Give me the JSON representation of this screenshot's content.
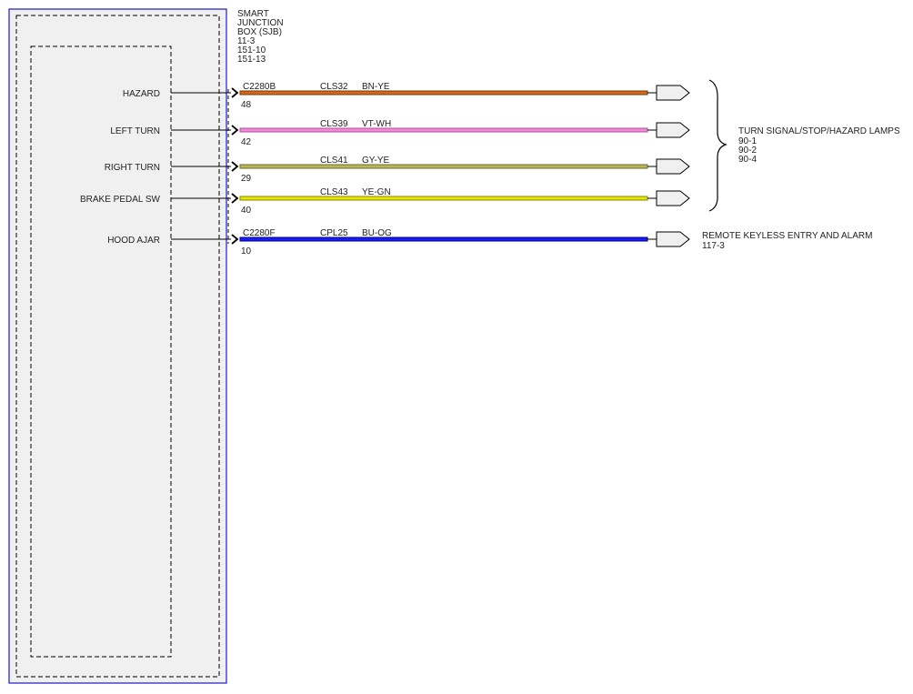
{
  "sjb": {
    "title_lines": [
      "SMART",
      "JUNCTION",
      "BOX (SJB)",
      "11-3",
      "151-10",
      "151-13"
    ]
  },
  "circuits": [
    {
      "input_label": "HAZARD",
      "connector": "C2280B",
      "pin": "48",
      "circuit": "CLS32",
      "wire_color": "BN-YE",
      "fill": "#d2691e",
      "stroke": "#7a3400"
    },
    {
      "input_label": "LEFT TURN",
      "connector": "",
      "pin": "42",
      "circuit": "CLS39",
      "wire_color": "VT-WH",
      "fill": "#f28ad8",
      "stroke": "#b04fa0"
    },
    {
      "input_label": "RIGHT TURN",
      "connector": "",
      "pin": "29",
      "circuit": "CLS41",
      "wire_color": "GY-YE",
      "fill": "#b8b85a",
      "stroke": "#6d6d2d"
    },
    {
      "input_label": "BRAKE PEDAL SW",
      "connector": "",
      "pin": "40",
      "circuit": "CLS43",
      "wire_color": "YE-GN",
      "fill": "#e6e600",
      "stroke": "#8a8a00"
    },
    {
      "input_label": "HOOD AJAR",
      "connector": "C2280F",
      "pin": "10",
      "circuit": "CPL25",
      "wire_color": "BU-OG",
      "fill": "#1a1aff",
      "stroke": "#00007a"
    }
  ],
  "destinations": {
    "turn_signal": {
      "lines": [
        "TURN SIGNAL/STOP/HAZARD LAMPS",
        "90-1",
        "90-2",
        "90-4"
      ]
    },
    "keyless": {
      "lines": [
        "REMOTE KEYLESS ENTRY AND ALARM",
        "117-3"
      ]
    }
  },
  "colors": {
    "outline_blue": "#1a1acc",
    "box_fill": "#f0f0f0"
  }
}
